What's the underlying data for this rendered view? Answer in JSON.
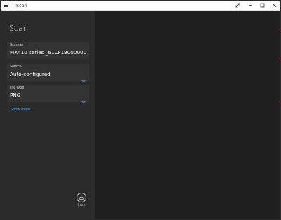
{
  "window": {
    "title": "Scan"
  },
  "page": {
    "title": "Scan"
  },
  "fields": {
    "scanner": {
      "label": "Scanner",
      "value": "MX410 series _61CF19000000"
    },
    "source": {
      "label": "Source",
      "value": "Auto-configured"
    },
    "file_type": {
      "label": "File type",
      "value": "PNG"
    }
  },
  "links": {
    "show_more": "Show more"
  },
  "actions": {
    "scan_label": "Scan"
  },
  "icons": {
    "menu": "hamburger-icon",
    "expand": "expand-icon",
    "minimize": "minimize-icon",
    "maximize": "maximize-icon",
    "close": "close-icon",
    "chevron": "chevron-down-icon",
    "scan": "scanner-icon"
  },
  "colors": {
    "accent": "#4ea1f3",
    "panel": "#2b2b2b",
    "background": "#1f1f1f"
  }
}
